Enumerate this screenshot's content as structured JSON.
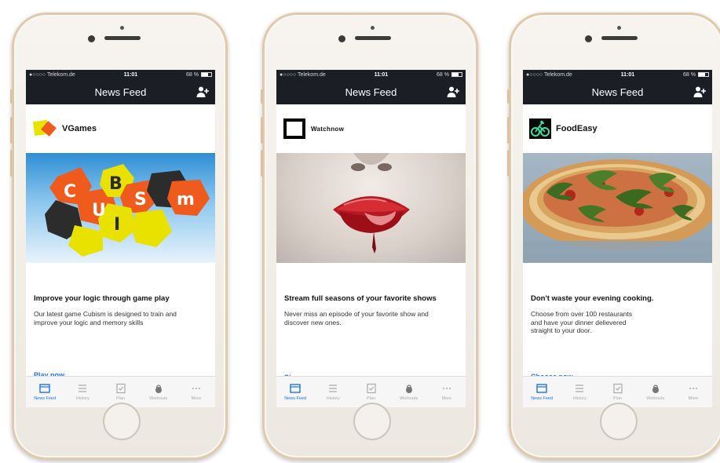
{
  "phones": [
    {
      "status": {
        "carrier": "●○○○○ Telekom.de",
        "time": "11:01",
        "battery": "68 %"
      },
      "nav": {
        "title": "News Feed"
      },
      "ad": {
        "brand": "VGames",
        "hero_letters": [
          "C",
          "B",
          "S",
          "m",
          "U",
          "I"
        ],
        "headline": "Improve your logic through game play",
        "description": "Our latest game Cubism is designed to train and\nimprove your logic and memory skills",
        "cta": "Play now"
      },
      "tabs": [
        "News Feed",
        "History",
        "Plan",
        "Workouts",
        "More"
      ]
    },
    {
      "status": {
        "carrier": "●○○○○ Telekom.de",
        "time": "11:01",
        "battery": "68 %"
      },
      "nav": {
        "title": "News Feed"
      },
      "ad": {
        "brand": "Watchnow",
        "headline": "Stream full seasons of your favorite shows",
        "description": "Never miss an episode of your favorite show and\ndiscover new ones.",
        "cta": "Stream now"
      },
      "tabs": [
        "News Feed",
        "History",
        "Plan",
        "Workouts",
        "More"
      ]
    },
    {
      "status": {
        "carrier": "●○○○○ Telekom.de",
        "time": "11:01",
        "battery": "68 %"
      },
      "nav": {
        "title": "News Feed"
      },
      "ad": {
        "brand": "FoodEasy",
        "headline": "Don't waste your evening cooking.",
        "description": "Choose from over 100 restaurants\nand have your dinner delievered\nstraight to your door.",
        "cta": "Choose now"
      },
      "tabs": [
        "News Feed",
        "History",
        "Plan",
        "Workouts",
        "More"
      ]
    }
  ],
  "colors": {
    "bar": "#1b1e25",
    "accent": "#1a73e8"
  }
}
